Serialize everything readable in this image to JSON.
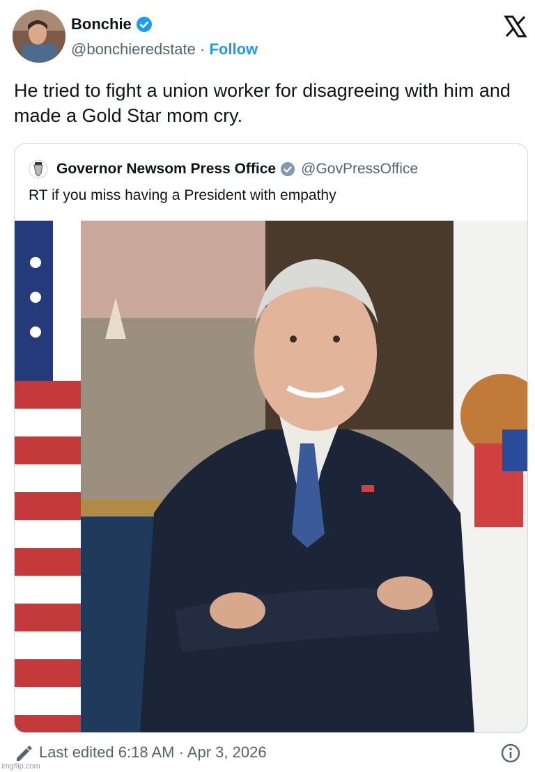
{
  "user": {
    "name": "Bonchie",
    "handle": "@bonchieredstate",
    "separator": "·",
    "follow_label": "Follow"
  },
  "tweet": {
    "text": "He tried to fight a union worker for disagreeing with him and made a Gold Star mom cry."
  },
  "quote": {
    "name": "Governor Newsom Press Office",
    "handle": "@GovPressOffice",
    "text": "RT if you miss having a President with empathy"
  },
  "footer": {
    "edited_text": "Last edited 6:18 AM · Apr 3, 2026"
  },
  "watermark": "imgflip.com",
  "icons": [
    "verified-badge-icon",
    "x-logo-icon",
    "pencil-icon",
    "info-icon"
  ],
  "colors": {
    "accent": "#1d9bf0",
    "text": "#0f1419",
    "muted": "#536471",
    "border": "#cfd9de"
  }
}
